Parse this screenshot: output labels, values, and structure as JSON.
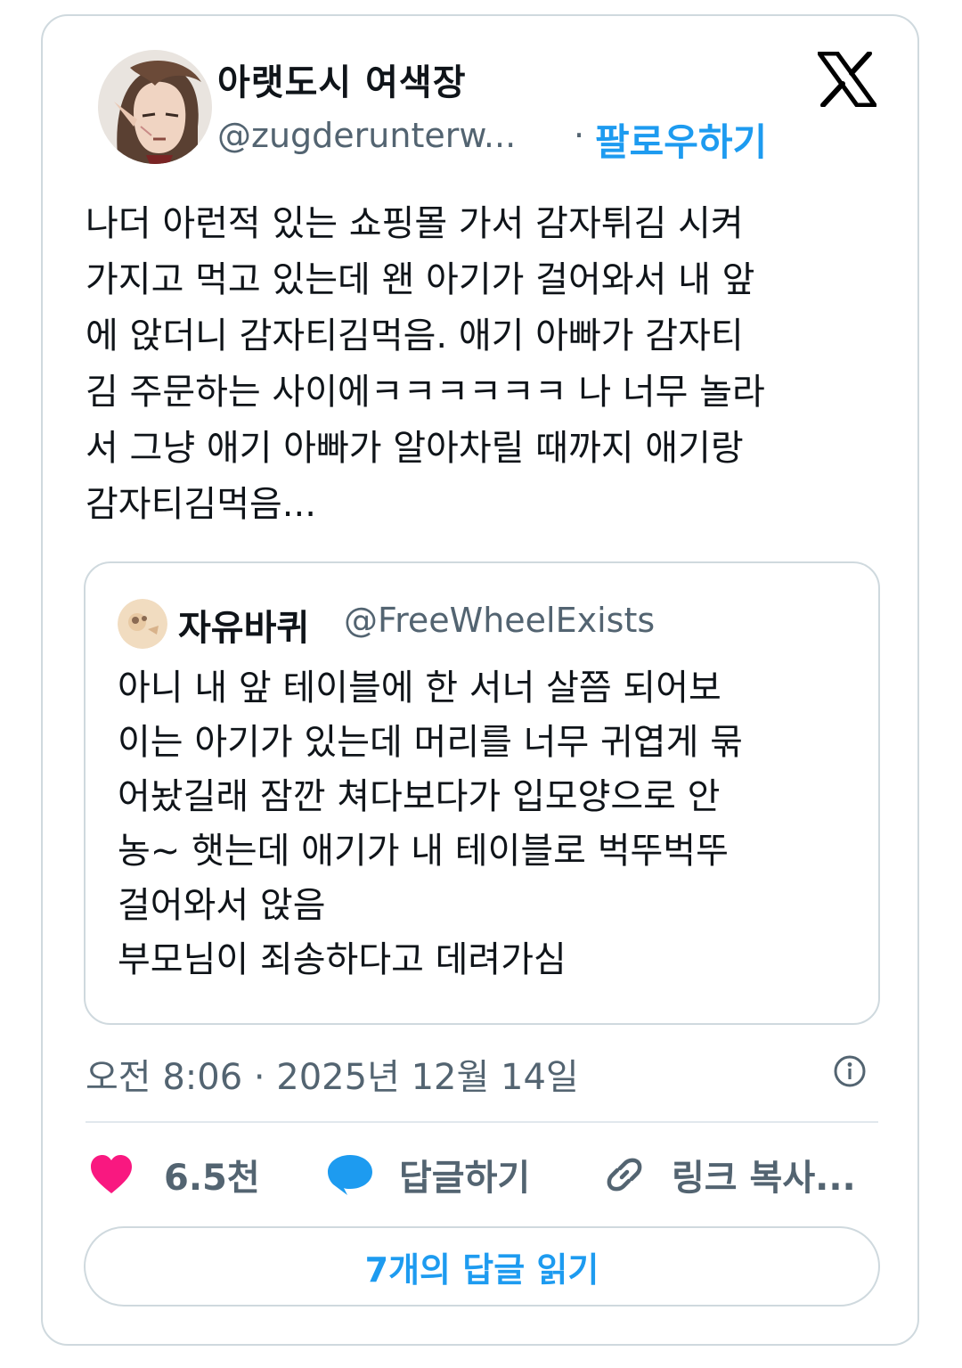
{
  "author": {
    "display_name": "아랫도시 여색장",
    "handle": "@zugderunterw...",
    "separator": "·",
    "follow_label": "팔로우하기"
  },
  "tweet": {
    "text": "나더 아런적 있는 쇼핑몰 가서 감자튀김 시켜\n가지고 먹고 있는데 왠 아기가 걸어와서 내 앞\n에 앉더니 감자티김먹음. 애기 아빠가 감자티\n김 주문하는 사이에ㅋㅋㅋㅋㅋㅋ 나 너무 놀라\n서 그냥 애기 아빠가 알아차릴 때까지 애기랑\n감자티김먹음...",
    "timestamp": "오전 8:06 · 2025년 12월 14일"
  },
  "quoted_tweet": {
    "display_name": "자유바퀴",
    "handle": "@FreeWheelExists",
    "text": "아니 내 앞 테이블에 한 서너 살쯤 되어보\n이는 아기가 있는데 머리를 너무 귀엽게 묶\n어놨길래 잠깐 쳐다보다가 입모양으로 안\n농~ 햇는데 애기가 내 테이블로 벅뚜벅뚜\n걸어와서 앉음\n부모님이 죄송하다고 데려가심"
  },
  "actions": {
    "like_count": "6.5천",
    "reply_label": "답글하기",
    "copy_link_label": "링크 복사..."
  },
  "read_replies_label": "7개의 답글 읽기",
  "colors": {
    "accent": "#1d9bf0",
    "like": "#f91880",
    "secondary_text": "#536471",
    "border": "#cfd9de"
  },
  "icons": [
    "x-logo-icon",
    "info-icon",
    "heart-icon",
    "speech-bubble-icon",
    "link-icon"
  ]
}
